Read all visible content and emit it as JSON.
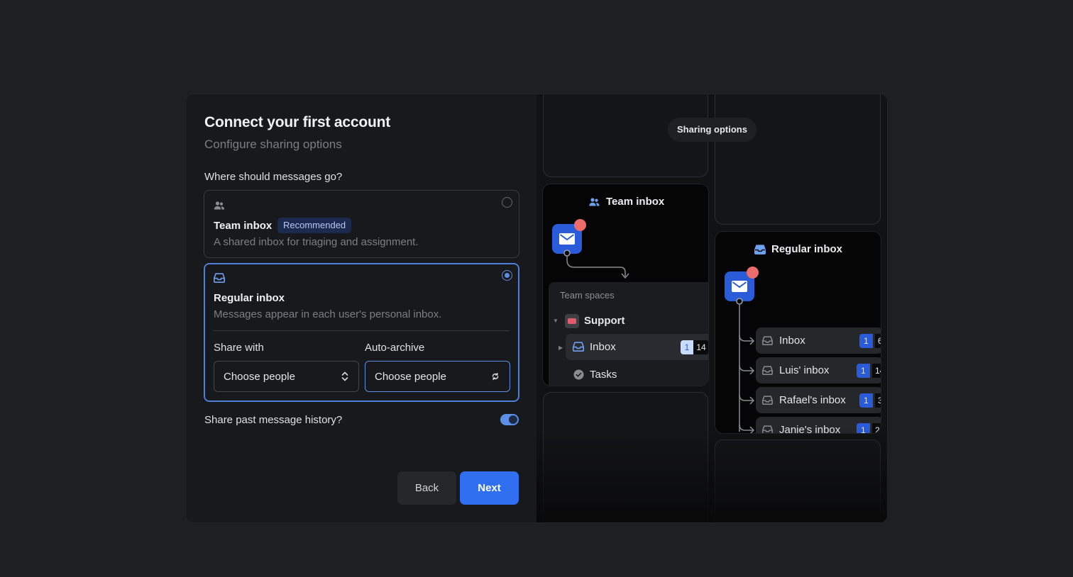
{
  "header": {
    "title": "Connect your first account",
    "subtitle": "Configure sharing options"
  },
  "question": "Where should messages go?",
  "options": {
    "team": {
      "title": "Team inbox",
      "badge": "Recommended",
      "description": "A shared inbox for triaging and assignment.",
      "icon": "people-icon",
      "selected": false
    },
    "regular": {
      "title": "Regular inbox",
      "description": "Messages appear in each user's personal inbox.",
      "icon": "inbox-icon",
      "selected": true,
      "share_with": {
        "label": "Share with",
        "value": "Choose people"
      },
      "auto_archive": {
        "label": "Auto-archive",
        "value": "Choose people"
      }
    }
  },
  "history": {
    "label": "Share past message history?",
    "enabled": true
  },
  "footer": {
    "back_label": "Back",
    "next_label": "Next"
  },
  "preview": {
    "pill_label": "Sharing options",
    "team_pane": {
      "title": "Team inbox",
      "section_label": "Team spaces",
      "space_name": "Support",
      "inbox_label": "Inbox",
      "inbox_unread": "1",
      "inbox_total": "14",
      "tasks_label": "Tasks"
    },
    "regular_pane": {
      "title": "Regular inbox",
      "items": [
        {
          "label": "Inbox",
          "unread": "1",
          "total": "6"
        },
        {
          "label": "Luis' inbox",
          "unread": "1",
          "total": "14"
        },
        {
          "label": "Rafael's inbox",
          "unread": "1",
          "total": "3"
        },
        {
          "label": "Janie's inbox",
          "unread": "1",
          "total": "2"
        }
      ]
    }
  },
  "colors": {
    "accent": "#2f6ff0",
    "selected_border": "#4d7fd6",
    "notification": "#ec6b6b"
  }
}
